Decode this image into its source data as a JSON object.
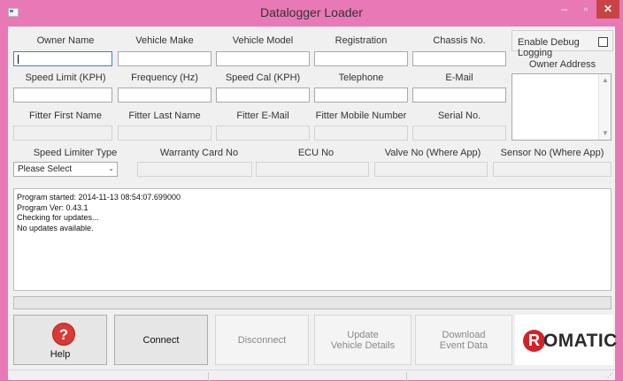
{
  "window": {
    "title": "Datalogger Loader",
    "controls": {
      "minimize": "–",
      "maximize": "▫",
      "close": "✕"
    }
  },
  "form": {
    "row1_labels": [
      "Owner Name",
      "Vehicle Make",
      "Vehicle Model",
      "Registration",
      "Chassis No."
    ],
    "row2_labels": [
      "Speed Limit (KPH)",
      "Frequency (Hz)",
      "Speed Cal (KPH)",
      "Telephone",
      "E-Mail"
    ],
    "row3_labels": [
      "Fitter First Name",
      "Fitter Last Name",
      "Fitter E-Mail",
      "Fitter Mobile Number",
      "Serial No."
    ],
    "row4_labels": [
      "Speed Limiter Type",
      "Warranty Card No",
      "ECU No",
      "Valve No (Where App)",
      "Sensor No (Where App)"
    ],
    "debug_logging": {
      "label": "Enable Debug Logging",
      "checked": false
    },
    "owner_address_label": "Owner Address",
    "speed_limiter_type": {
      "selected": "Please Select",
      "arrow_icon": "chevron-down-icon"
    }
  },
  "log": {
    "lines": [
      "Program started: 2014-11-13 08:54:07.699000",
      "Program Ver: 0.43.1",
      "Checking for updates...",
      "No updates available."
    ]
  },
  "progress": {
    "value": 0
  },
  "buttons": {
    "help": "Help",
    "connect": "Connect",
    "disconnect": "Disconnect",
    "update_vehicle_details": "Update\nVehicle Details",
    "download_event_data": "Download\nEvent Data"
  },
  "logo": {
    "brand": "ROMATIC",
    "mark": "R",
    "colors": {
      "mark": "#d1232a",
      "text": "#2b2b2b"
    }
  },
  "colors": {
    "titlebar": "#e879b6",
    "close": "#c74444",
    "focus": "#3c7fd0"
  }
}
